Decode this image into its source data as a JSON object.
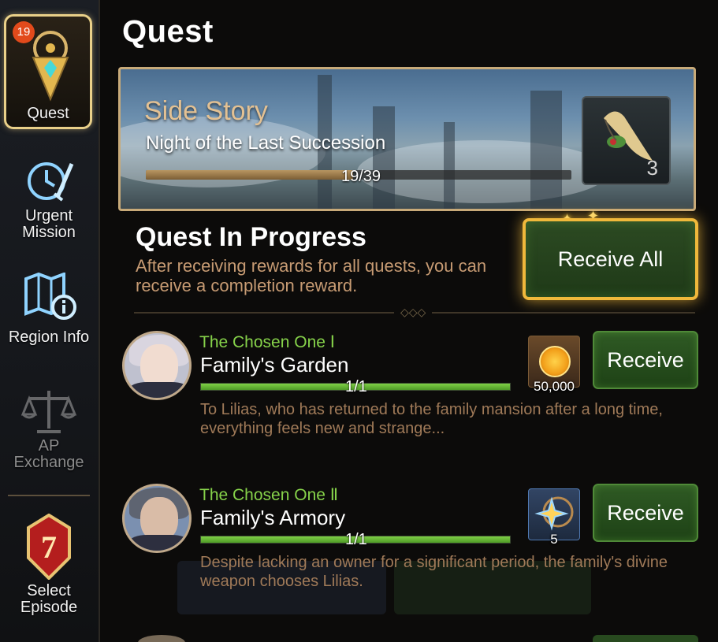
{
  "sidebar": {
    "badge_count": "19",
    "items": [
      {
        "label": "Quest"
      },
      {
        "label": "Urgent\nMission"
      },
      {
        "label": "Region Info"
      },
      {
        "label": "AP\nExchange"
      },
      {
        "label": "Select\nEpisode"
      }
    ]
  },
  "header": {
    "title": "Quest"
  },
  "side_story": {
    "label": "Side Story",
    "name": "Night of the Last Succession",
    "progress_text": "19/39",
    "progress": 0.487,
    "reward_qty": "3"
  },
  "in_progress": {
    "title": "Quest In Progress",
    "description": "After receiving rewards for all quests, you can receive a completion reward.",
    "receive_all_label": "Receive All"
  },
  "quests": [
    {
      "chapter": "The Chosen One Ⅰ",
      "name": "Family's Garden",
      "progress_text": "1/1",
      "progress": 1.0,
      "description": "To Lilias, who has returned to the family mansion after a long time, everything feels new and strange...",
      "reward_qty": "50,000",
      "reward_icon": "gold-coin-icon",
      "button_label": "Receive"
    },
    {
      "chapter": "The Chosen One Ⅱ",
      "name": "Family's Armory",
      "progress_text": "1/1",
      "progress": 1.0,
      "description": "Despite lacking an owner for a significant period, the family's divine weapon chooses Lilias.",
      "reward_qty": "5",
      "reward_icon": "star-amulet-icon",
      "button_label": "Receive"
    }
  ],
  "colors": {
    "accent_gold": "#f0b83b",
    "chapter_green": "#86d24a",
    "desc_tan": "#c79b73"
  }
}
